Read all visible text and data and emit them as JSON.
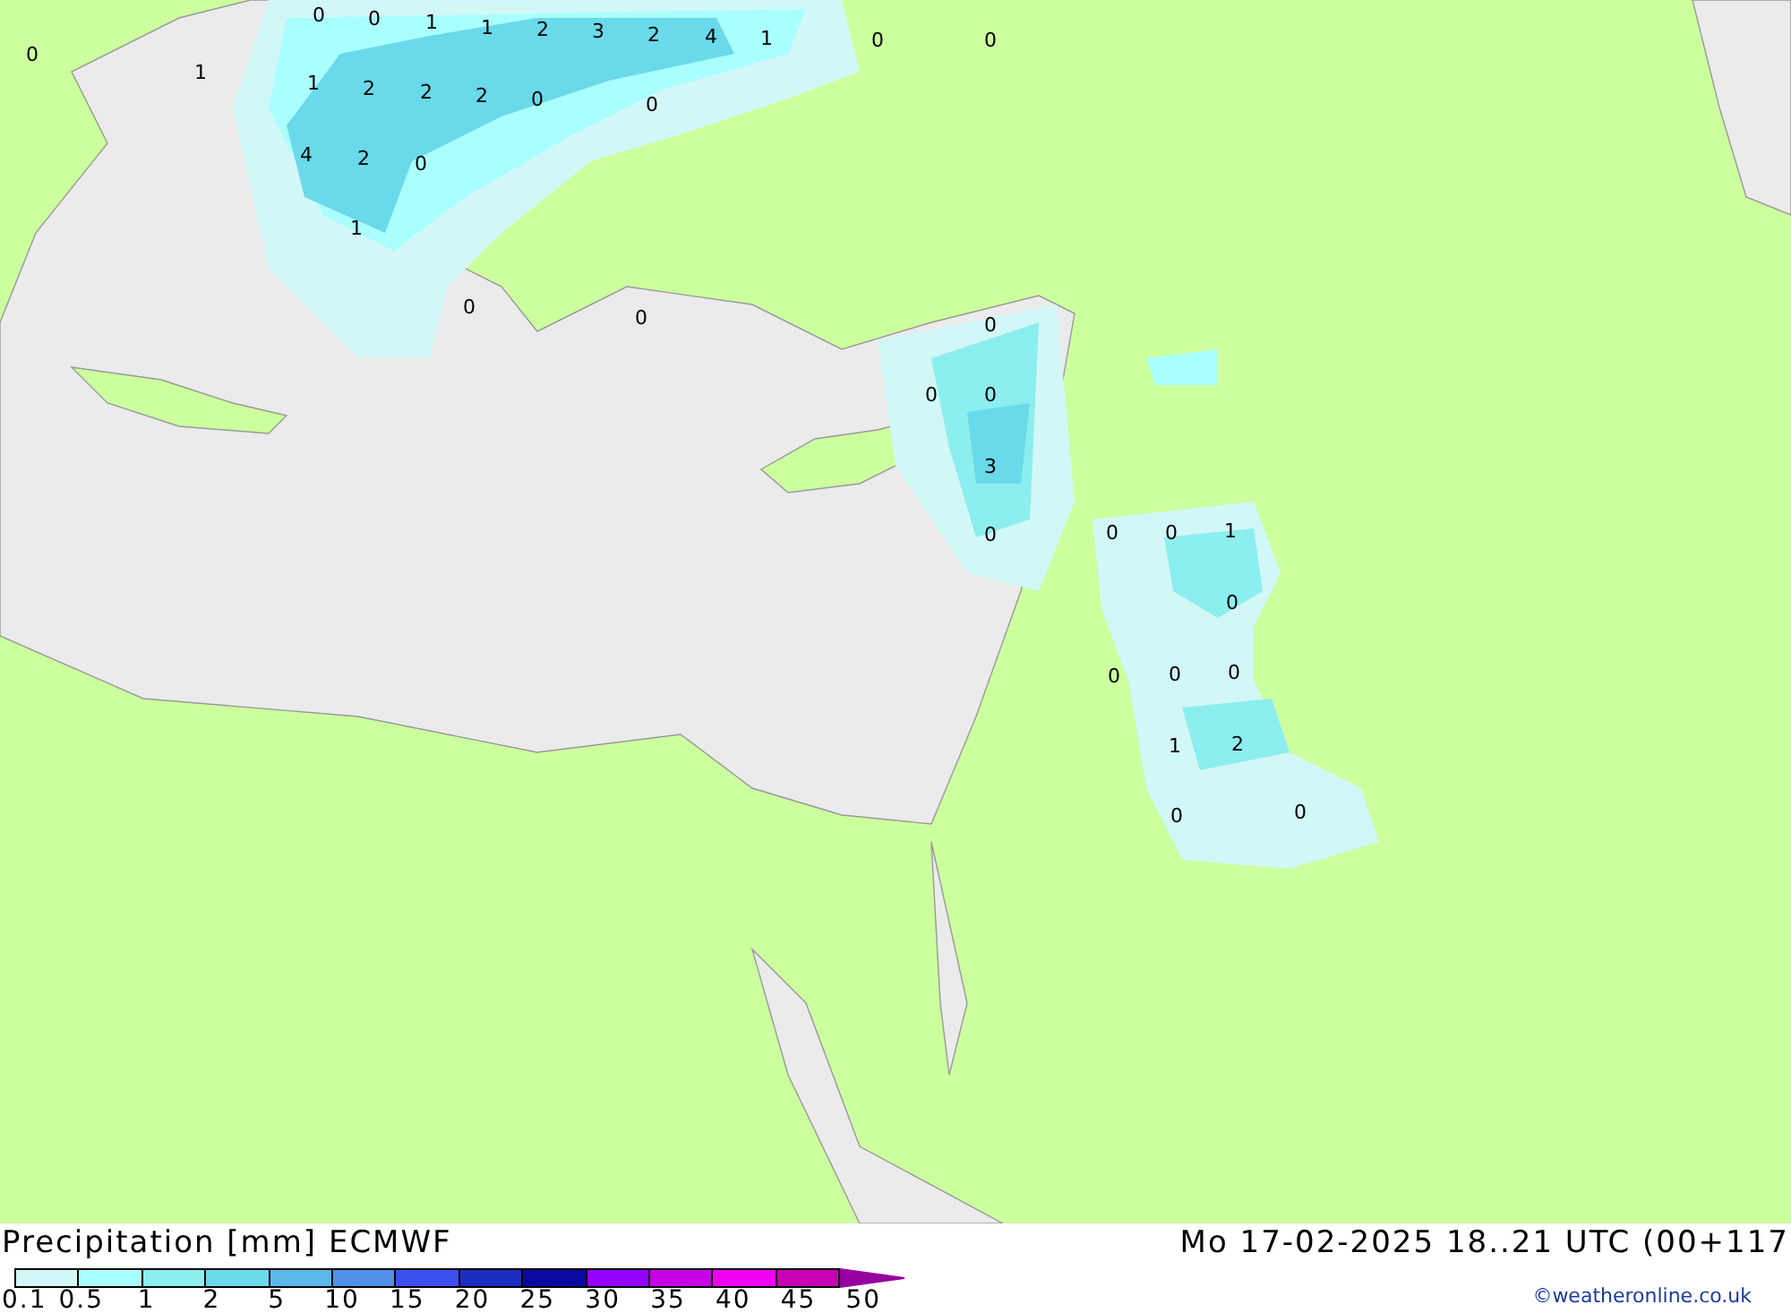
{
  "map": {
    "value_labels": [
      "0",
      "0",
      "0",
      "1",
      "1",
      "2",
      "3",
      "2",
      "4",
      "1",
      "0",
      "0",
      "1",
      "1",
      "2",
      "2",
      "2",
      "0",
      "0",
      "4",
      "2",
      "0",
      "1",
      "0",
      "0",
      "0",
      "0",
      "0",
      "3",
      "0",
      "0",
      "0",
      "1",
      "0",
      "0",
      "0",
      "0",
      "1",
      "2",
      "0",
      "0"
    ]
  },
  "legend": {
    "title": "Precipitation [mm] ECMWF",
    "classes": [
      {
        "kind": "band",
        "color": "#d2f7f7"
      },
      {
        "kind": "band",
        "color": "#aaffff"
      },
      {
        "kind": "band",
        "color": "#8ceeee"
      },
      {
        "kind": "band",
        "color": "#6ad9ea"
      },
      {
        "kind": "band",
        "color": "#5ab8e8"
      },
      {
        "kind": "band",
        "color": "#5090e8"
      },
      {
        "kind": "band",
        "color": "#3c50f0"
      },
      {
        "kind": "band",
        "color": "#1c2ec0"
      },
      {
        "kind": "band",
        "color": "#0a0aa0"
      },
      {
        "kind": "band",
        "color": "#9400ff"
      },
      {
        "kind": "band",
        "color": "#c800e6"
      },
      {
        "kind": "band",
        "color": "#f000f0"
      },
      {
        "kind": "band",
        "color": "#c800b4"
      },
      {
        "kind": "arrow",
        "color": "#9600a0"
      }
    ],
    "ticks": [
      "0.1",
      "0.5",
      "1",
      "2",
      "5",
      "10",
      "15",
      "20",
      "25",
      "30",
      "35",
      "40",
      "45",
      "50"
    ]
  },
  "valid_time": "Mo 17-02-2025 18..21 UTC (00+117",
  "credit": "©weatheronline.co.uk"
}
